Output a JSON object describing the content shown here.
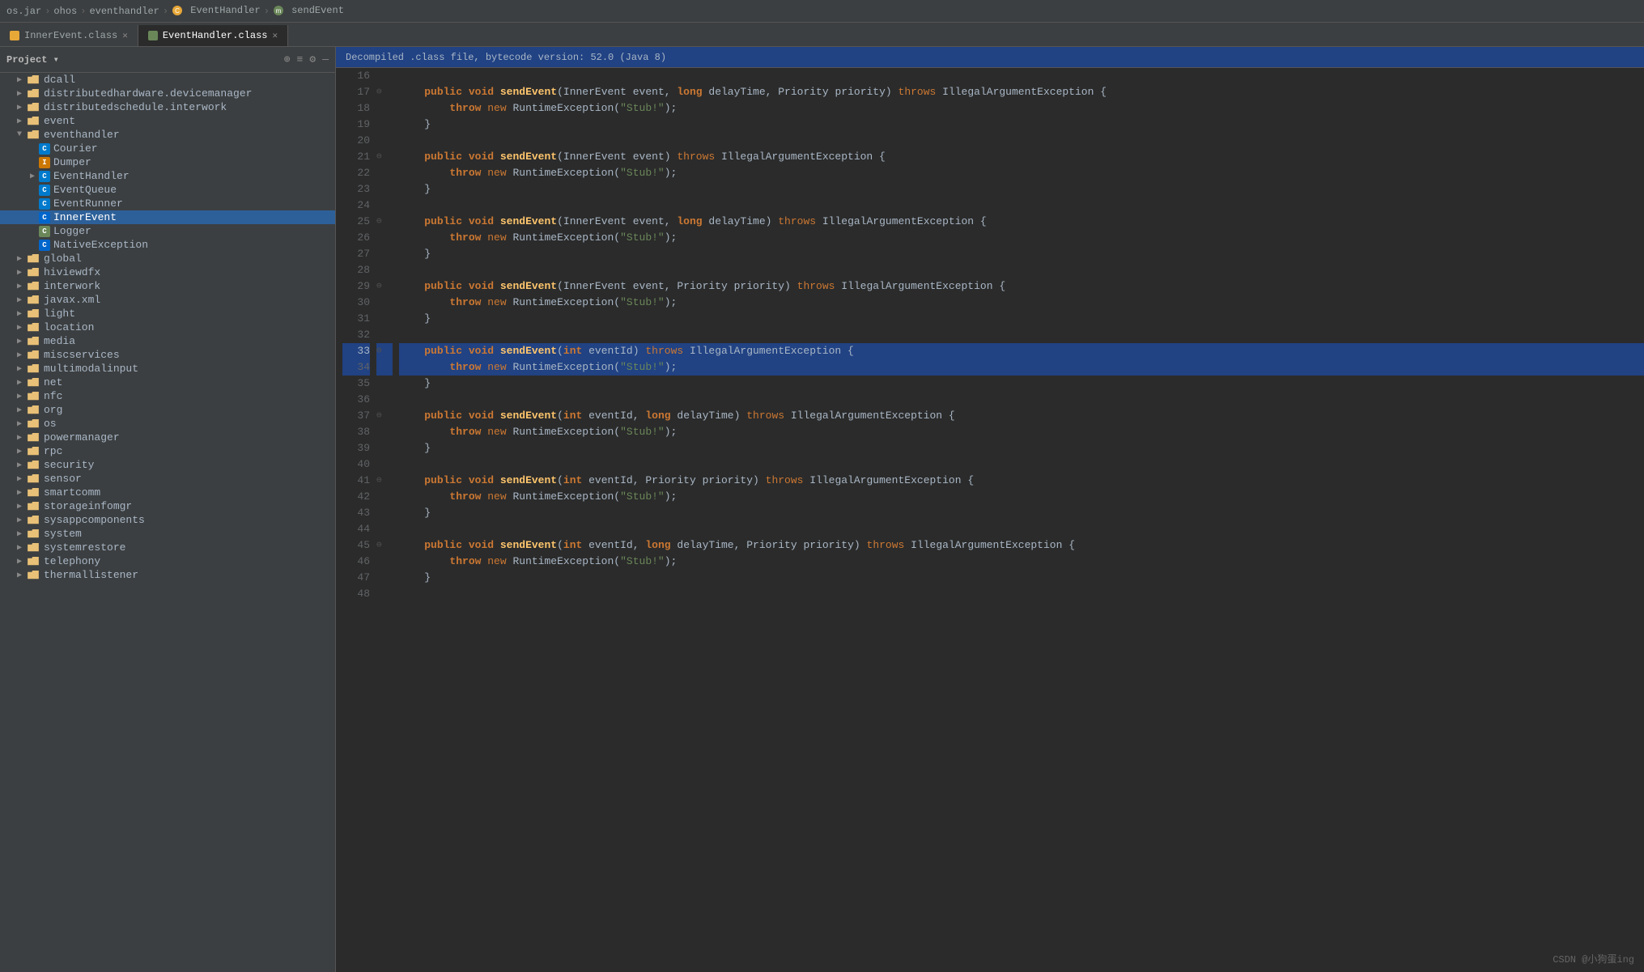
{
  "breadcrumb": {
    "items": [
      "os.jar",
      "ohos",
      "eventhandler",
      "EventHandler",
      "sendEvent"
    ],
    "separators": [
      "›",
      "›",
      "›",
      "›"
    ]
  },
  "tabs": [
    {
      "id": "inner-event",
      "label": "InnerEvent.class",
      "icon": "orange",
      "active": false
    },
    {
      "id": "event-handler",
      "label": "EventHandler.class",
      "icon": "green",
      "active": true
    }
  ],
  "sidebar": {
    "title": "Project",
    "tree": [
      {
        "id": "dcall",
        "level": 1,
        "type": "folder",
        "label": "dcall",
        "collapsed": true
      },
      {
        "id": "distributedhardware",
        "level": 1,
        "type": "folder",
        "label": "distributedhardware.devicemanager",
        "collapsed": true
      },
      {
        "id": "distributedschedule",
        "level": 1,
        "type": "folder",
        "label": "distributedschedule.interwork",
        "collapsed": true
      },
      {
        "id": "event",
        "level": 1,
        "type": "folder",
        "label": "event",
        "collapsed": true
      },
      {
        "id": "eventhandler",
        "level": 1,
        "type": "folder",
        "label": "eventhandler",
        "collapsed": false
      },
      {
        "id": "Courier",
        "level": 2,
        "type": "class-c",
        "label": "Courier"
      },
      {
        "id": "Dumper",
        "level": 2,
        "type": "class-i",
        "label": "Dumper"
      },
      {
        "id": "EventHandler",
        "level": 2,
        "type": "class-c",
        "label": "EventHandler",
        "collapsed": true
      },
      {
        "id": "EventQueue",
        "level": 2,
        "type": "class-c",
        "label": "EventQueue"
      },
      {
        "id": "EventRunner",
        "level": 2,
        "type": "class-c",
        "label": "EventRunner"
      },
      {
        "id": "InnerEvent",
        "level": 2,
        "type": "class-c",
        "label": "InnerEvent",
        "selected": true
      },
      {
        "id": "Logger",
        "level": 2,
        "type": "class-g",
        "label": "Logger"
      },
      {
        "id": "NativeException",
        "level": 2,
        "type": "class-c",
        "label": "NativeException"
      },
      {
        "id": "global",
        "level": 1,
        "type": "folder",
        "label": "global",
        "collapsed": true
      },
      {
        "id": "hiviewdfx",
        "level": 1,
        "type": "folder",
        "label": "hiviewdfx",
        "collapsed": true
      },
      {
        "id": "interwork",
        "level": 1,
        "type": "folder",
        "label": "interwork",
        "collapsed": true
      },
      {
        "id": "javax.xml",
        "level": 1,
        "type": "folder",
        "label": "javax.xml",
        "collapsed": true
      },
      {
        "id": "light",
        "level": 1,
        "type": "folder",
        "label": "light",
        "collapsed": true
      },
      {
        "id": "location",
        "level": 1,
        "type": "folder",
        "label": "location",
        "collapsed": true
      },
      {
        "id": "media",
        "level": 1,
        "type": "folder",
        "label": "media",
        "collapsed": true
      },
      {
        "id": "miscservices",
        "level": 1,
        "type": "folder",
        "label": "miscservices",
        "collapsed": true
      },
      {
        "id": "multimodalinput",
        "level": 1,
        "type": "folder",
        "label": "multimodalinput",
        "collapsed": true
      },
      {
        "id": "net",
        "level": 1,
        "type": "folder",
        "label": "net",
        "collapsed": true
      },
      {
        "id": "nfc",
        "level": 1,
        "type": "folder",
        "label": "nfc",
        "collapsed": true
      },
      {
        "id": "org",
        "level": 1,
        "type": "folder",
        "label": "org",
        "collapsed": true
      },
      {
        "id": "os",
        "level": 1,
        "type": "folder",
        "label": "os",
        "collapsed": true
      },
      {
        "id": "powermanager",
        "level": 1,
        "type": "folder",
        "label": "powermanager",
        "collapsed": true
      },
      {
        "id": "rpc",
        "level": 1,
        "type": "folder",
        "label": "rpc",
        "collapsed": true
      },
      {
        "id": "security",
        "level": 1,
        "type": "folder",
        "label": "security",
        "collapsed": true
      },
      {
        "id": "sensor",
        "level": 1,
        "type": "folder",
        "label": "sensor",
        "collapsed": true
      },
      {
        "id": "smartcomm",
        "level": 1,
        "type": "folder",
        "label": "smartcomm",
        "collapsed": true
      },
      {
        "id": "storageinfomgr",
        "level": 1,
        "type": "folder",
        "label": "storageinfomgr",
        "collapsed": true
      },
      {
        "id": "sysappcomponents",
        "level": 1,
        "type": "folder",
        "label": "sysappcomponents",
        "collapsed": true
      },
      {
        "id": "system",
        "level": 1,
        "type": "folder",
        "label": "system",
        "collapsed": true
      },
      {
        "id": "systemrestore",
        "level": 1,
        "type": "folder",
        "label": "systemrestore",
        "collapsed": true
      },
      {
        "id": "telephony",
        "level": 1,
        "type": "folder",
        "label": "telephony",
        "collapsed": true
      },
      {
        "id": "thermallistener",
        "level": 1,
        "type": "folder",
        "label": "thermallistener",
        "collapsed": true
      }
    ]
  },
  "decompiled_banner": "Decompiled .class file, bytecode version: 52.0 (Java 8)",
  "code": {
    "lines": [
      {
        "num": 16,
        "content": "",
        "gutter": false,
        "highlighted": false
      },
      {
        "num": 17,
        "content": "    public void sendEvent(InnerEvent event, long delayTime, Priority priority) throws IllegalArgumentException {",
        "gutter": true,
        "highlighted": false
      },
      {
        "num": 18,
        "content": "        throw new RuntimeException(\"Stub!\");",
        "gutter": false,
        "highlighted": false
      },
      {
        "num": 19,
        "content": "    }",
        "gutter": false,
        "highlighted": false
      },
      {
        "num": 20,
        "content": "",
        "gutter": false,
        "highlighted": false
      },
      {
        "num": 21,
        "content": "    public void sendEvent(InnerEvent event) throws IllegalArgumentException {",
        "gutter": true,
        "highlighted": false
      },
      {
        "num": 22,
        "content": "        throw new RuntimeException(\"Stub!\");",
        "gutter": false,
        "highlighted": false
      },
      {
        "num": 23,
        "content": "    }",
        "gutter": false,
        "highlighted": false
      },
      {
        "num": 24,
        "content": "",
        "gutter": false,
        "highlighted": false
      },
      {
        "num": 25,
        "content": "    public void sendEvent(InnerEvent event, long delayTime) throws IllegalArgumentException {",
        "gutter": true,
        "highlighted": false
      },
      {
        "num": 26,
        "content": "        throw new RuntimeException(\"Stub!\");",
        "gutter": false,
        "highlighted": false
      },
      {
        "num": 27,
        "content": "    }",
        "gutter": false,
        "highlighted": false
      },
      {
        "num": 28,
        "content": "",
        "gutter": false,
        "highlighted": false
      },
      {
        "num": 29,
        "content": "    public void sendEvent(InnerEvent event, Priority priority) throws IllegalArgumentException {",
        "gutter": true,
        "highlighted": false
      },
      {
        "num": 30,
        "content": "        throw new RuntimeException(\"Stub!\");",
        "gutter": false,
        "highlighted": false
      },
      {
        "num": 31,
        "content": "    }",
        "gutter": false,
        "highlighted": false
      },
      {
        "num": 32,
        "content": "",
        "gutter": false,
        "highlighted": false
      },
      {
        "num": 33,
        "content": "    public void sendEvent(int eventId) throws IllegalArgumentException {",
        "gutter": true,
        "highlighted": true
      },
      {
        "num": 34,
        "content": "        throw new RuntimeException(\"Stub!\");",
        "gutter": false,
        "highlighted": true
      },
      {
        "num": 35,
        "content": "    }",
        "gutter": false,
        "highlighted": false
      },
      {
        "num": 36,
        "content": "",
        "gutter": false,
        "highlighted": false
      },
      {
        "num": 37,
        "content": "    public void sendEvent(int eventId, long delayTime) throws IllegalArgumentException {",
        "gutter": true,
        "highlighted": false
      },
      {
        "num": 38,
        "content": "        throw new RuntimeException(\"Stub!\");",
        "gutter": false,
        "highlighted": false
      },
      {
        "num": 39,
        "content": "    }",
        "gutter": false,
        "highlighted": false
      },
      {
        "num": 40,
        "content": "",
        "gutter": false,
        "highlighted": false
      },
      {
        "num": 41,
        "content": "    public void sendEvent(int eventId, Priority priority) throws IllegalArgumentException {",
        "gutter": true,
        "highlighted": false
      },
      {
        "num": 42,
        "content": "        throw new RuntimeException(\"Stub!\");",
        "gutter": false,
        "highlighted": false
      },
      {
        "num": 43,
        "content": "    }",
        "gutter": false,
        "highlighted": false
      },
      {
        "num": 44,
        "content": "",
        "gutter": false,
        "highlighted": false
      },
      {
        "num": 45,
        "content": "    public void sendEvent(int eventId, long delayTime, Priority priority) throws IllegalArgumentException {",
        "gutter": true,
        "highlighted": false
      },
      {
        "num": 46,
        "content": "        throw new RuntimeException(\"Stub!\");",
        "gutter": false,
        "highlighted": false
      },
      {
        "num": 47,
        "content": "    }",
        "gutter": false,
        "highlighted": false
      },
      {
        "num": 48,
        "content": "",
        "gutter": false,
        "highlighted": false
      }
    ]
  },
  "watermark": "CSDN @小狗蛋ing"
}
